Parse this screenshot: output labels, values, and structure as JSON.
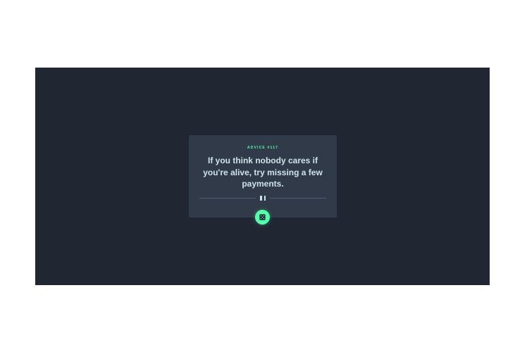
{
  "card": {
    "advice_label": "ADVICE #117",
    "quote": "If you think nobody cares if you're alive, try missing a few payments."
  },
  "controls": {
    "dice_icon": "dice-icon",
    "pause_icon": "pause-icon"
  },
  "colors": {
    "background": "#202733",
    "card": "#313a48",
    "accent": "#53ffaa",
    "text": "#cee3e9",
    "divider": "#4f5d74"
  }
}
